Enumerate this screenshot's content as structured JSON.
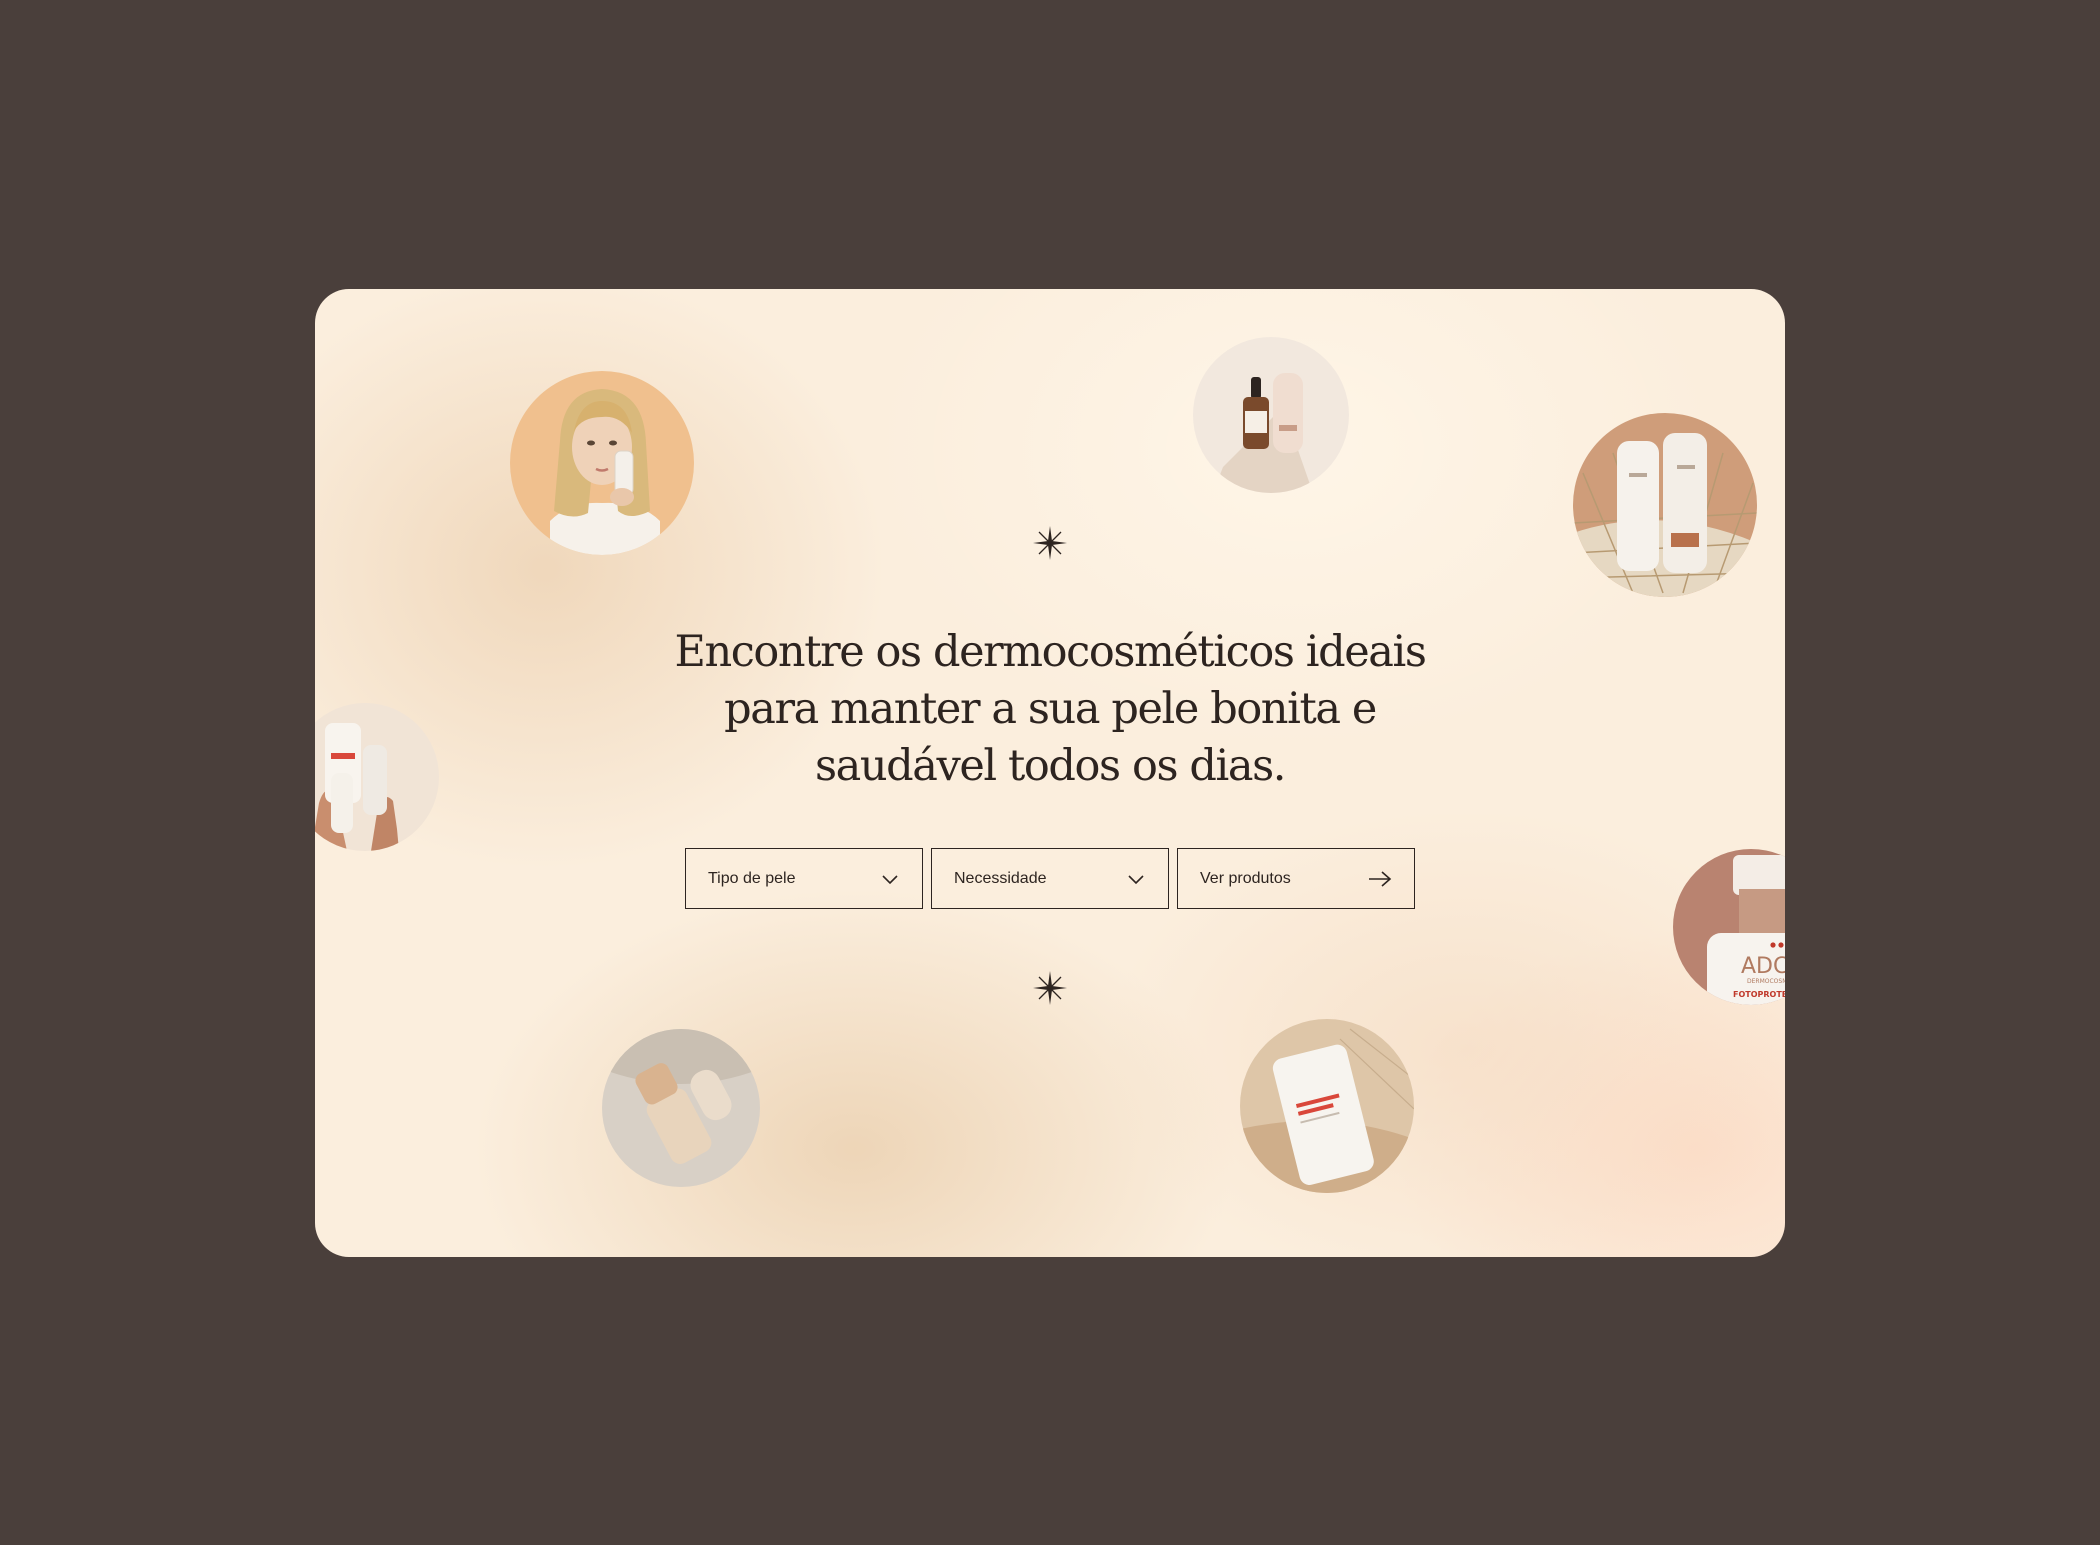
{
  "hero": {
    "headline": "Encontre os dermocosméticos ideais para manter a sua pele bonita e saudável todos os dias."
  },
  "filters": {
    "skin_type_label": "Tipo de pele",
    "need_label": "Necessidade",
    "cta_label": "Ver produtos"
  },
  "icons": {
    "filter_icon": "chevron-down-icon",
    "cta_icon": "arrow-right-icon",
    "ornament": "sparkle-star-icon"
  },
  "colors": {
    "page_background": "#4a3f3b",
    "card_background": "#fbeedd",
    "text": "#2d2420",
    "product_accent": "#c0392b"
  },
  "product_brand": {
    "name": "ADCOS",
    "subline": "DERMOCOSMÉTICOS",
    "sunscreen_text": "FOTOPROTEÇÃO"
  }
}
